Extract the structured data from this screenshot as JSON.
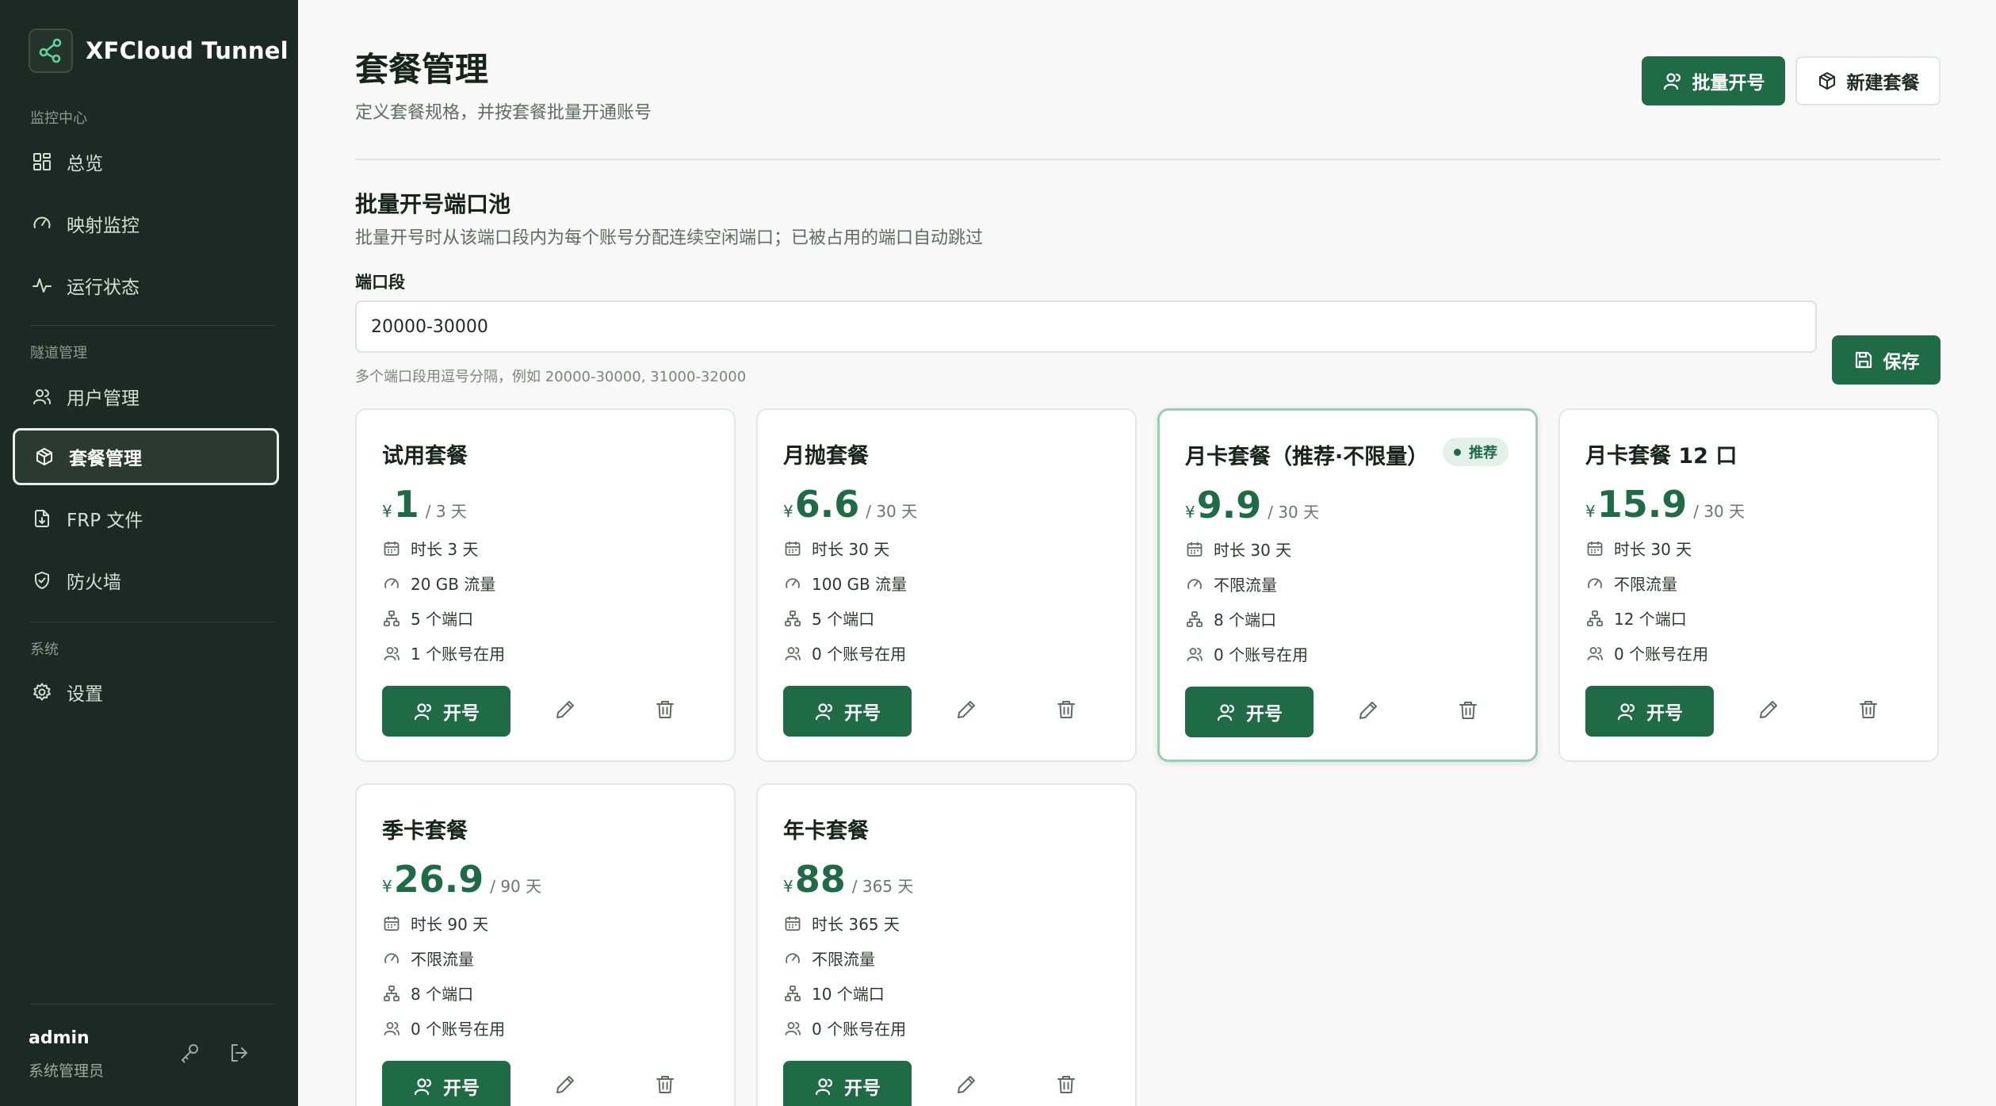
{
  "brand": {
    "name": "XFCloud Tunnel",
    "icon": "logo-network-icon"
  },
  "sidebar": {
    "sections": [
      {
        "label": "监控中心"
      },
      {
        "label": "隧道管理"
      },
      {
        "label": "系统"
      }
    ],
    "items": [
      {
        "label": "总览",
        "icon": "dashboard-icon"
      },
      {
        "label": "映射监控",
        "icon": "gauge-icon"
      },
      {
        "label": "运行状态",
        "icon": "activity-icon"
      },
      {
        "label": "用户管理",
        "icon": "users-icon"
      },
      {
        "label": "套餐管理",
        "icon": "package-icon",
        "active": true
      },
      {
        "label": "FRP 文件",
        "icon": "file-download-icon"
      },
      {
        "label": "防火墙",
        "icon": "shield-icon"
      },
      {
        "label": "设置",
        "icon": "gear-icon"
      }
    ],
    "user": {
      "name": "admin",
      "role": "系统管理员"
    }
  },
  "header": {
    "title": "套餐管理",
    "subtitle": "定义套餐规格，并按套餐批量开通账号",
    "batch_open_label": "批量开号",
    "new_plan_label": "新建套餐"
  },
  "port_pool": {
    "title": "批量开号端口池",
    "description": "批量开号时从该端口段内为每个账号分配连续空闲端口；已被占用的端口自动跳过",
    "field_label": "端口段",
    "value": "20000-30000",
    "hint": "多个端口段用逗号分隔，例如 20000-30000, 31000-32000",
    "save_label": "保存"
  },
  "plans": [
    {
      "name": "试用套餐",
      "currency": "¥",
      "price": "1",
      "period": "/ 3 天",
      "duration": "时长 3 天",
      "traffic": "20 GB 流量",
      "ports": "5 个端口",
      "accounts": "1 个账号在用",
      "open_label": "开号",
      "featured": false
    },
    {
      "name": "月抛套餐",
      "currency": "¥",
      "price": "6.6",
      "period": "/ 30 天",
      "duration": "时长 30 天",
      "traffic": "100 GB 流量",
      "ports": "5 个端口",
      "accounts": "0 个账号在用",
      "open_label": "开号",
      "featured": false
    },
    {
      "name": "月卡套餐（推荐·不限量）",
      "currency": "¥",
      "price": "9.9",
      "period": "/ 30 天",
      "duration": "时长 30 天",
      "traffic": "不限流量",
      "ports": "8 个端口",
      "accounts": "0 个账号在用",
      "open_label": "开号",
      "featured": true,
      "badge": "推荐"
    },
    {
      "name": "月卡套餐 12 口",
      "currency": "¥",
      "price": "15.9",
      "period": "/ 30 天",
      "duration": "时长 30 天",
      "traffic": "不限流量",
      "ports": "12 个端口",
      "accounts": "0 个账号在用",
      "open_label": "开号",
      "featured": false
    },
    {
      "name": "季卡套餐",
      "currency": "¥",
      "price": "26.9",
      "period": "/ 90 天",
      "duration": "时长 90 天",
      "traffic": "不限流量",
      "ports": "8 个端口",
      "accounts": "0 个账号在用",
      "open_label": "开号",
      "featured": false
    },
    {
      "name": "年卡套餐",
      "currency": "¥",
      "price": "88",
      "period": "/ 365 天",
      "duration": "时长 365 天",
      "traffic": "不限流量",
      "ports": "10 个端口",
      "accounts": "0 个账号在用",
      "open_label": "开号",
      "featured": false
    }
  ],
  "colors": {
    "accent": "#1e6b45",
    "sidebar_bg": "#1b2a24",
    "page_bg": "#f7f8f7",
    "badge_bg": "#e3f1ea"
  }
}
